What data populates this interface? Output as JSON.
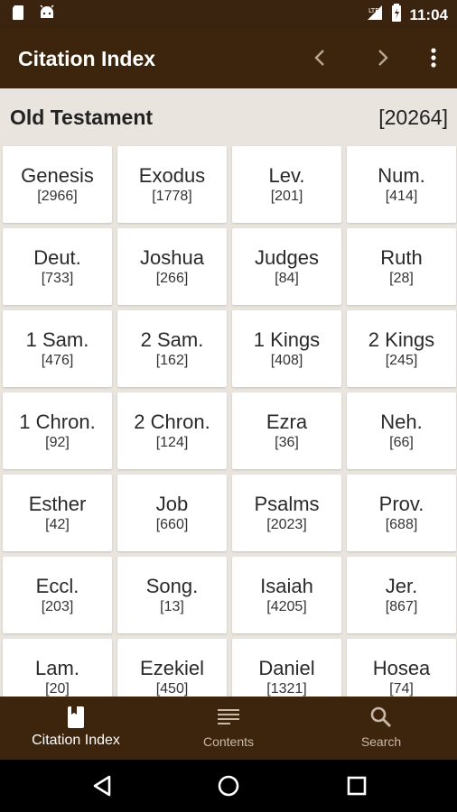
{
  "status_bar": {
    "time": "11:04",
    "left_icons": [
      "sd-card-icon",
      "android-icon"
    ],
    "right_icons": [
      "signal-icon",
      "battery-icon"
    ]
  },
  "app_bar": {
    "title": "Citation Index",
    "actions": [
      "chevron-left-icon",
      "chevron-right-icon",
      "more-vertical-icon"
    ]
  },
  "section": {
    "title": "Old Testament",
    "count": "[20264]"
  },
  "books": [
    {
      "name": "Genesis",
      "count": "[2966]"
    },
    {
      "name": "Exodus",
      "count": "[1778]"
    },
    {
      "name": "Lev.",
      "count": "[201]"
    },
    {
      "name": "Num.",
      "count": "[414]"
    },
    {
      "name": "Deut.",
      "count": "[733]"
    },
    {
      "name": "Joshua",
      "count": "[266]"
    },
    {
      "name": "Judges",
      "count": "[84]"
    },
    {
      "name": "Ruth",
      "count": "[28]"
    },
    {
      "name": "1 Sam.",
      "count": "[476]"
    },
    {
      "name": "2 Sam.",
      "count": "[162]"
    },
    {
      "name": "1 Kings",
      "count": "[408]"
    },
    {
      "name": "2 Kings",
      "count": "[245]"
    },
    {
      "name": "1 Chron.",
      "count": "[92]"
    },
    {
      "name": "2 Chron.",
      "count": "[124]"
    },
    {
      "name": "Ezra",
      "count": "[36]"
    },
    {
      "name": "Neh.",
      "count": "[66]"
    },
    {
      "name": "Esther",
      "count": "[42]"
    },
    {
      "name": "Job",
      "count": "[660]"
    },
    {
      "name": "Psalms",
      "count": "[2023]"
    },
    {
      "name": "Prov.",
      "count": "[688]"
    },
    {
      "name": "Eccl.",
      "count": "[203]"
    },
    {
      "name": "Song.",
      "count": "[13]"
    },
    {
      "name": "Isaiah",
      "count": "[4205]"
    },
    {
      "name": "Jer.",
      "count": "[867]"
    },
    {
      "name": "Lam.",
      "count": "[20]"
    },
    {
      "name": "Ezekiel",
      "count": "[450]"
    },
    {
      "name": "Daniel",
      "count": "[1321]"
    },
    {
      "name": "Hosea",
      "count": "[74]"
    }
  ],
  "bottom_nav": [
    {
      "label": "Citation Index",
      "icon": "book-icon",
      "active": true
    },
    {
      "label": "Contents",
      "icon": "list-icon",
      "active": false
    },
    {
      "label": "Search",
      "icon": "search-icon",
      "active": false
    }
  ],
  "system_nav": [
    "back-icon",
    "home-icon",
    "recents-icon"
  ],
  "colors": {
    "app_bar": "#3d240d",
    "status_bar": "#3a2410",
    "background": "#e9e4de",
    "card": "#ffffff"
  }
}
